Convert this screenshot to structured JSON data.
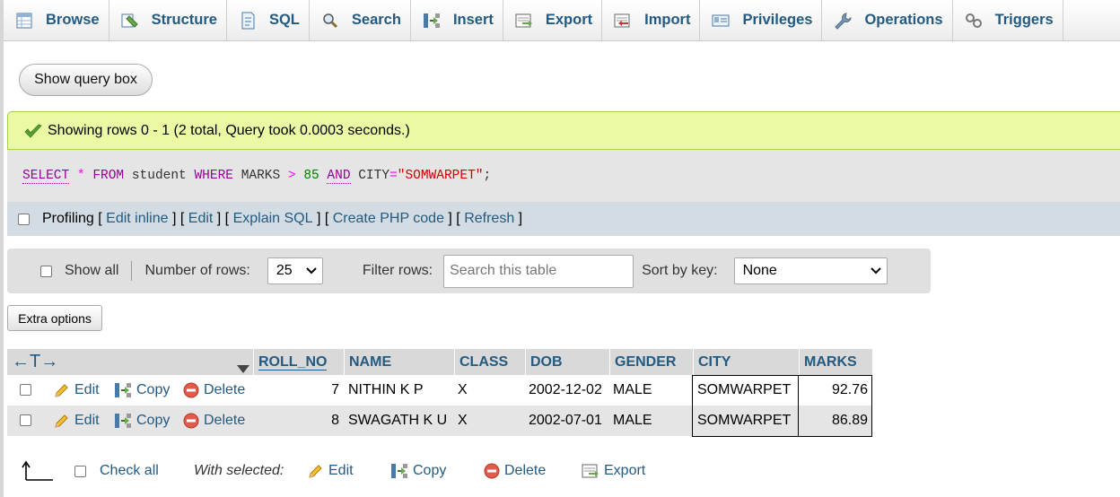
{
  "tabs": [
    {
      "label": "Browse",
      "icon": "browse-icon"
    },
    {
      "label": "Structure",
      "icon": "structure-icon"
    },
    {
      "label": "SQL",
      "icon": "sql-icon"
    },
    {
      "label": "Search",
      "icon": "search-icon"
    },
    {
      "label": "Insert",
      "icon": "insert-icon"
    },
    {
      "label": "Export",
      "icon": "export-icon"
    },
    {
      "label": "Import",
      "icon": "import-icon"
    },
    {
      "label": "Privileges",
      "icon": "privileges-icon"
    },
    {
      "label": "Operations",
      "icon": "operations-icon"
    },
    {
      "label": "Triggers",
      "icon": "triggers-icon"
    }
  ],
  "query_box_button": "Show query box",
  "success_message": "Showing rows 0 - 1 (2 total, Query took 0.0003 seconds.)",
  "sql": {
    "select": "SELECT",
    "star": "*",
    "from": "FROM",
    "table": "student",
    "where": "WHERE",
    "col1": "MARKS",
    "gt": ">",
    "num": "85",
    "and": "AND",
    "col2": "CITY",
    "eq": "=",
    "str": "\"SOMWARPET\"",
    "semi": ";"
  },
  "profiling": {
    "label": "Profiling",
    "links": [
      "Edit inline",
      "Edit",
      "Explain SQL",
      "Create PHP code",
      "Refresh"
    ]
  },
  "navigation": {
    "show_all": "Show all",
    "rows_label": "Number of rows:",
    "rows_value": "25",
    "filter_label": "Filter rows:",
    "filter_placeholder": "Search this table",
    "sort_label": "Sort by key:",
    "sort_value": "None"
  },
  "extra_options": "Extra options",
  "table": {
    "arrows": "←T→",
    "columns": [
      "ROLL_NO",
      "NAME",
      "CLASS",
      "DOB",
      "GENDER",
      "CITY",
      "MARKS"
    ],
    "actions": {
      "edit": "Edit",
      "copy": "Copy",
      "delete": "Delete"
    },
    "rows": [
      {
        "ROLL_NO": "7",
        "NAME": "NITHIN K P",
        "CLASS": "X",
        "DOB": "2002-12-02",
        "GENDER": "MALE",
        "CITY": "SOMWARPET",
        "MARKS": "92.76"
      },
      {
        "ROLL_NO": "8",
        "NAME": "SWAGATH K U",
        "CLASS": "X",
        "DOB": "2002-07-01",
        "GENDER": "MALE",
        "CITY": "SOMWARPET",
        "MARKS": "86.89"
      }
    ]
  },
  "bulk": {
    "check_all": "Check all",
    "with_selected": "With selected:",
    "edit": "Edit",
    "copy": "Copy",
    "delete": "Delete",
    "export": "Export"
  },
  "colors": {
    "link": "#235a81",
    "success_bg": "#ebf8a4",
    "header_bg": "#d9d9d9"
  }
}
